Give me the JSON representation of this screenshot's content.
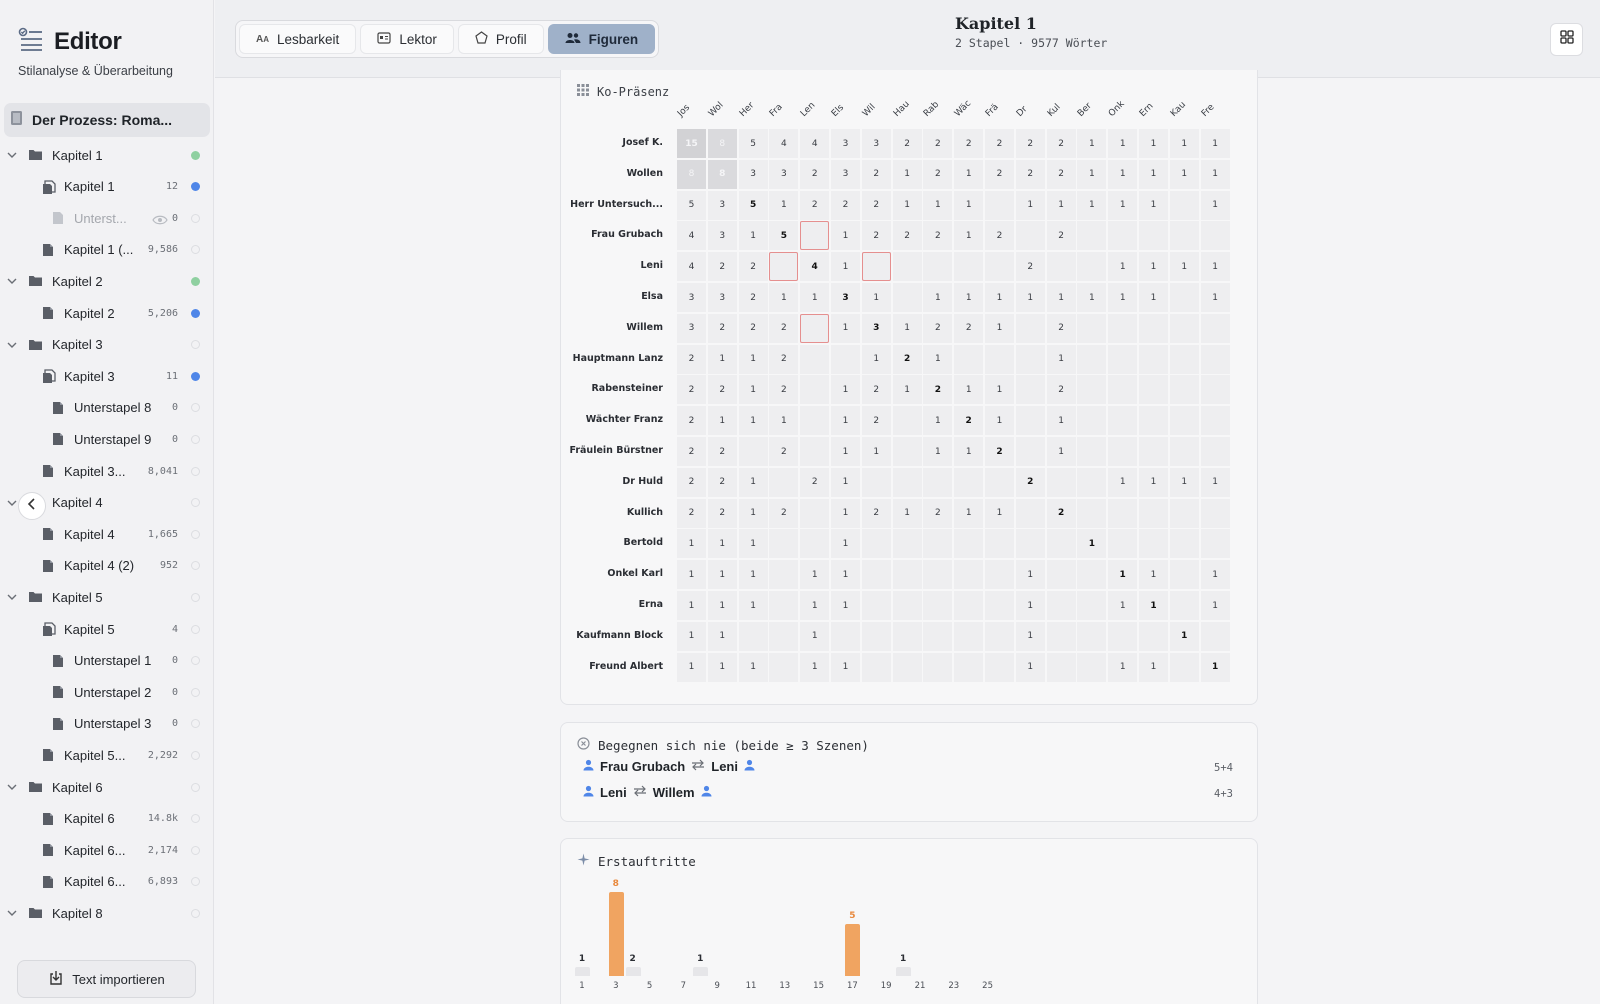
{
  "app": {
    "title": "Editor",
    "subtitle": "Stilanalyse & Überarbeitung",
    "project_title": "Der Prozess: Roma...",
    "import_label": "Text importieren"
  },
  "tree": [
    {
      "kind": "folder",
      "label": "Kapitel 1",
      "count": "",
      "dot": "green",
      "level": 0
    },
    {
      "kind": "stack",
      "label": "Kapitel 1",
      "count": "12",
      "dot": "blue",
      "level": 1
    },
    {
      "kind": "doc-hidden",
      "label": "Unterst...",
      "count": "0",
      "dot": "empty",
      "level": 2
    },
    {
      "kind": "doc",
      "label": "Kapitel 1 (...",
      "count": "9,586",
      "dot": "empty",
      "level": 1
    },
    {
      "kind": "folder",
      "label": "Kapitel 2",
      "count": "",
      "dot": "green",
      "level": 0
    },
    {
      "kind": "doc",
      "label": "Kapitel 2",
      "count": "5,206",
      "dot": "blue",
      "level": 1
    },
    {
      "kind": "folder",
      "label": "Kapitel 3",
      "count": "",
      "dot": "empty",
      "level": 0
    },
    {
      "kind": "stack",
      "label": "Kapitel 3",
      "count": "11",
      "dot": "blue",
      "level": 1
    },
    {
      "kind": "doc",
      "label": "Unterstapel 8",
      "count": "0",
      "dot": "empty",
      "level": 2
    },
    {
      "kind": "doc",
      "label": "Unterstapel 9",
      "count": "0",
      "dot": "empty",
      "level": 2
    },
    {
      "kind": "doc",
      "label": "Kapitel 3...",
      "count": "8,041",
      "dot": "empty",
      "level": 1
    },
    {
      "kind": "folder",
      "label": "Kapitel 4",
      "count": "",
      "dot": "empty",
      "level": 0
    },
    {
      "kind": "doc",
      "label": "Kapitel 4",
      "count": "1,665",
      "dot": "empty",
      "level": 1
    },
    {
      "kind": "doc",
      "label": "Kapitel 4 (2)",
      "count": "952",
      "dot": "empty",
      "level": 1
    },
    {
      "kind": "folder",
      "label": "Kapitel 5",
      "count": "",
      "dot": "empty",
      "level": 0
    },
    {
      "kind": "stack",
      "label": "Kapitel 5",
      "count": "4",
      "dot": "empty",
      "level": 1
    },
    {
      "kind": "doc",
      "label": "Unterstapel 1",
      "count": "0",
      "dot": "empty",
      "level": 2
    },
    {
      "kind": "doc",
      "label": "Unterstapel 2",
      "count": "0",
      "dot": "empty",
      "level": 2
    },
    {
      "kind": "doc",
      "label": "Unterstapel 3",
      "count": "0",
      "dot": "empty",
      "level": 2
    },
    {
      "kind": "doc",
      "label": "Kapitel 5...",
      "count": "2,292",
      "dot": "empty",
      "level": 1
    },
    {
      "kind": "folder",
      "label": "Kapitel 6",
      "count": "",
      "dot": "empty",
      "level": 0
    },
    {
      "kind": "doc",
      "label": "Kapitel 6",
      "count": "14.8k",
      "dot": "empty",
      "level": 1
    },
    {
      "kind": "doc",
      "label": "Kapitel 6...",
      "count": "2,174",
      "dot": "empty",
      "level": 1
    },
    {
      "kind": "doc",
      "label": "Kapitel 6...",
      "count": "6,893",
      "dot": "empty",
      "level": 1
    },
    {
      "kind": "folder",
      "label": "Kapitel 8",
      "count": "",
      "dot": "empty",
      "level": 0
    }
  ],
  "tabs": [
    {
      "label": "Lesbarkeit",
      "icon": "text-size-icon",
      "active": false
    },
    {
      "label": "Lektor",
      "icon": "id-card-icon",
      "active": false
    },
    {
      "label": "Profil",
      "icon": "pentagon-icon",
      "active": false
    },
    {
      "label": "Figuren",
      "icon": "users-icon",
      "active": true
    }
  ],
  "document": {
    "title": "Kapitel 1",
    "subtitle": "2 Stapel · 9577 Wörter"
  },
  "copresence": {
    "title": "Ko-Präsenz",
    "col_abbr": [
      "Jos",
      "Wol",
      "Her",
      "Fra",
      "Len",
      "Els",
      "Wil",
      "Hau",
      "Rab",
      "Wäc",
      "Frä",
      "Dr",
      "Kul",
      "Ber",
      "Onk",
      "Ern",
      "Kau",
      "Fre"
    ],
    "rows": [
      {
        "name": "Josef K.",
        "values": [
          "15",
          "8",
          "5",
          "4",
          "4",
          "3",
          "3",
          "2",
          "2",
          "2",
          "2",
          "2",
          "2",
          "1",
          "1",
          "1",
          "1",
          "1"
        ]
      },
      {
        "name": "Wollen",
        "values": [
          "8",
          "8",
          "3",
          "3",
          "2",
          "3",
          "2",
          "1",
          "2",
          "1",
          "2",
          "2",
          "2",
          "1",
          "1",
          "1",
          "1",
          "1"
        ]
      },
      {
        "name": "Herr Untersuch...",
        "values": [
          "5",
          "3",
          "5",
          "1",
          "2",
          "2",
          "2",
          "1",
          "1",
          "1",
          "",
          "1",
          "1",
          "1",
          "1",
          "1",
          "",
          "1"
        ]
      },
      {
        "name": "Frau Grubach",
        "values": [
          "4",
          "3",
          "1",
          "5",
          "",
          "1",
          "2",
          "2",
          "2",
          "1",
          "2",
          "",
          "2",
          "",
          "",
          "",
          "",
          ""
        ]
      },
      {
        "name": "Leni",
        "values": [
          "4",
          "2",
          "2",
          "",
          "4",
          "1",
          "",
          "",
          "",
          "",
          "",
          "2",
          "",
          "",
          "1",
          "1",
          "1",
          "1"
        ]
      },
      {
        "name": "Elsa",
        "values": [
          "3",
          "3",
          "2",
          "1",
          "1",
          "3",
          "1",
          "",
          "1",
          "1",
          "1",
          "1",
          "1",
          "1",
          "1",
          "1",
          "",
          "1"
        ]
      },
      {
        "name": "Willem",
        "values": [
          "3",
          "2",
          "2",
          "2",
          "",
          "1",
          "3",
          "1",
          "2",
          "2",
          "1",
          "",
          "2",
          "",
          "",
          "",
          "",
          ""
        ]
      },
      {
        "name": "Hauptmann Lanz",
        "values": [
          "2",
          "1",
          "1",
          "2",
          "",
          "",
          "1",
          "2",
          "1",
          "",
          "",
          "",
          "1",
          "",
          "",
          "",
          "",
          ""
        ]
      },
      {
        "name": "Rabensteiner",
        "values": [
          "2",
          "2",
          "1",
          "2",
          "",
          "1",
          "2",
          "1",
          "2",
          "1",
          "1",
          "",
          "2",
          "",
          "",
          "",
          "",
          ""
        ]
      },
      {
        "name": "Wächter Franz",
        "values": [
          "2",
          "1",
          "1",
          "1",
          "",
          "1",
          "2",
          "",
          "1",
          "2",
          "1",
          "",
          "1",
          "",
          "",
          "",
          "",
          ""
        ]
      },
      {
        "name": "Fräulein Bürstner",
        "values": [
          "2",
          "2",
          "",
          "2",
          "",
          "1",
          "1",
          "",
          "1",
          "1",
          "2",
          "",
          "1",
          "",
          "",
          "",
          "",
          ""
        ]
      },
      {
        "name": "Dr Huld",
        "values": [
          "2",
          "2",
          "1",
          "",
          "2",
          "1",
          "",
          "",
          "",
          "",
          "",
          "2",
          "",
          "",
          "1",
          "1",
          "1",
          "1"
        ]
      },
      {
        "name": "Kullich",
        "values": [
          "2",
          "2",
          "1",
          "2",
          "",
          "1",
          "2",
          "1",
          "2",
          "1",
          "1",
          "",
          "2",
          "",
          "",
          "",
          "",
          ""
        ]
      },
      {
        "name": "Bertold",
        "values": [
          "1",
          "1",
          "1",
          "",
          "",
          "1",
          "",
          "",
          "",
          "",
          "",
          "",
          "",
          "1",
          "",
          "",
          "",
          ""
        ]
      },
      {
        "name": "Onkel Karl",
        "values": [
          "1",
          "1",
          "1",
          "",
          "1",
          "1",
          "",
          "",
          "",
          "",
          "",
          "1",
          "",
          "",
          "1",
          "1",
          "",
          "1"
        ]
      },
      {
        "name": "Erna",
        "values": [
          "1",
          "1",
          "1",
          "",
          "1",
          "1",
          "",
          "",
          "",
          "",
          "",
          "1",
          "",
          "",
          "1",
          "1",
          "",
          "1"
        ]
      },
      {
        "name": "Kaufmann Block",
        "values": [
          "1",
          "1",
          "",
          "",
          "1",
          "",
          "",
          "",
          "",
          "",
          "",
          "1",
          "",
          "",
          "",
          "",
          "1",
          ""
        ]
      },
      {
        "name": "Freund Albert",
        "values": [
          "1",
          "1",
          "1",
          "",
          "1",
          "1",
          "",
          "",
          "",
          "",
          "",
          "1",
          "",
          "",
          "1",
          "1",
          "",
          "1"
        ]
      }
    ]
  },
  "never_meet": {
    "title": "Begegnen sich nie (beide ≥ 3 Szenen)",
    "pairs": [
      {
        "a": "Frau Grubach",
        "b": "Leni",
        "value": "5+4"
      },
      {
        "a": "Leni",
        "b": "Willem",
        "value": "4+3"
      }
    ]
  },
  "chart_data": {
    "type": "bar",
    "title": "Erstauftritte",
    "x": [
      1,
      2,
      3,
      4,
      5,
      6,
      7,
      8,
      9,
      10,
      11,
      12,
      13,
      14,
      15,
      16,
      17,
      18,
      19,
      20,
      21,
      22,
      23,
      24,
      25
    ],
    "values": [
      1,
      0,
      8,
      2,
      0,
      0,
      0,
      1,
      0,
      0,
      0,
      0,
      0,
      0,
      0,
      0,
      5,
      0,
      0,
      1,
      0,
      0,
      0,
      0,
      0
    ],
    "highlighted": [
      3,
      17
    ],
    "x_tick_labels": [
      "1",
      "3",
      "5",
      "7",
      "9",
      "11",
      "13",
      "15",
      "17",
      "19",
      "21",
      "23",
      "25"
    ],
    "colors": {
      "highlight": "#f0a461",
      "normal": "#e6e6e9"
    }
  }
}
